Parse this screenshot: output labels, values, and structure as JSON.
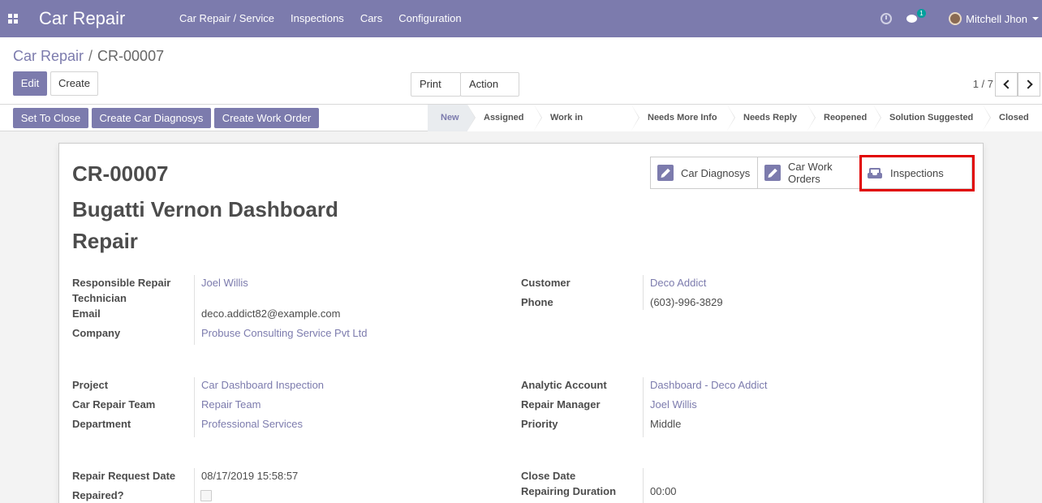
{
  "navbar": {
    "brand": "Car Repair",
    "menu": [
      "Car Repair / Service",
      "Inspections",
      "Cars",
      "Configuration"
    ],
    "chat_badge": "1",
    "user": "Mitchell Jhon",
    "icons": [
      "apps-icon",
      "clock-icon",
      "chat-icon"
    ]
  },
  "breadcrumb": {
    "parent": "Car Repair",
    "separator": "/",
    "current": "CR-00007"
  },
  "toolbar": {
    "edit": "Edit",
    "create": "Create",
    "print": "Print",
    "action": "Action"
  },
  "pager": {
    "value": "1 / 7"
  },
  "header_buttons": {
    "set_to_close": "Set To Close",
    "create_diagnosys": "Create Car Diagnosys",
    "create_work_order": "Create Work Order"
  },
  "stages": [
    "New",
    "Assigned",
    "Work in Progress",
    "Needs More Info",
    "Needs Reply",
    "Reopened",
    "Solution Suggested",
    "Closed"
  ],
  "active_stage": "New",
  "smart_buttons": {
    "diagnosys": "Car Diagnosys",
    "work_orders_1": "Car Work",
    "work_orders_2": "Orders",
    "inspections": "Inspections"
  },
  "record": {
    "ref": "CR-00007",
    "title_line1": "Bugatti Vernon Dashboard",
    "title_line2": "Repair"
  },
  "fields": {
    "responsible_label_1": "Responsible Repair",
    "responsible_label_2": "Technician",
    "responsible_value": "Joel Willis",
    "email_label": "Email",
    "email_value": "deco.addict82@example.com",
    "company_label": "Company",
    "company_value": "Probuse Consulting Service Pvt Ltd",
    "customer_label": "Customer",
    "customer_value": "Deco Addict",
    "phone_label": "Phone",
    "phone_value": "(603)-996-3829",
    "project_label": "Project",
    "project_value": "Car Dashboard Inspection",
    "team_label": "Car Repair Team",
    "team_value": "Repair Team",
    "department_label": "Department",
    "department_value": "Professional Services",
    "analytic_label": "Analytic Account",
    "analytic_value": "Dashboard - Deco Addict",
    "manager_label": "Repair Manager",
    "manager_value": "Joel Willis",
    "priority_label": "Priority",
    "priority_value": "Middle",
    "request_date_label": "Repair Request Date",
    "request_date_value": "08/17/2019 15:58:57",
    "repaired_label": "Repaired?",
    "close_date_label": "Close Date",
    "duration_label": "Repairing Duration",
    "duration_value": "00:00"
  },
  "colors": {
    "brand": "#7c7bad",
    "highlight": "#e10000"
  }
}
